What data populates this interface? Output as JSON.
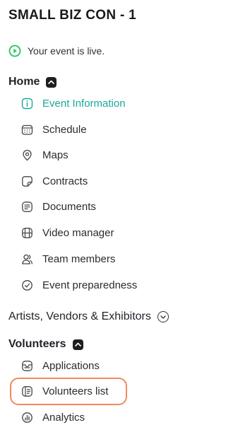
{
  "event_title": "SMALL BIZ CON - 1",
  "status": {
    "text": "Your event is live.",
    "color": "#22c55e"
  },
  "home": {
    "label": "Home",
    "expanded": true,
    "items": [
      {
        "label": "Event Information",
        "icon": "info-icon",
        "active": true
      },
      {
        "label": "Schedule",
        "icon": "calendar-icon"
      },
      {
        "label": "Maps",
        "icon": "map-pin-icon"
      },
      {
        "label": "Contracts",
        "icon": "contract-icon"
      },
      {
        "label": "Documents",
        "icon": "document-icon"
      },
      {
        "label": "Video manager",
        "icon": "film-icon"
      },
      {
        "label": "Team members",
        "icon": "team-icon"
      },
      {
        "label": "Event preparedness",
        "icon": "check-circle-icon"
      }
    ]
  },
  "artists": {
    "label": "Artists, Vendors & Exhibitors",
    "expanded": false
  },
  "volunteers": {
    "label": "Volunteers",
    "expanded": true,
    "items": [
      {
        "label": "Applications",
        "icon": "application-icon"
      },
      {
        "label": "Volunteers list",
        "icon": "list-icon",
        "highlighted": true
      },
      {
        "label": "Analytics",
        "icon": "analytics-icon"
      }
    ]
  },
  "colors": {
    "accent": "#1aa89a",
    "highlight": "#f08a5d"
  }
}
